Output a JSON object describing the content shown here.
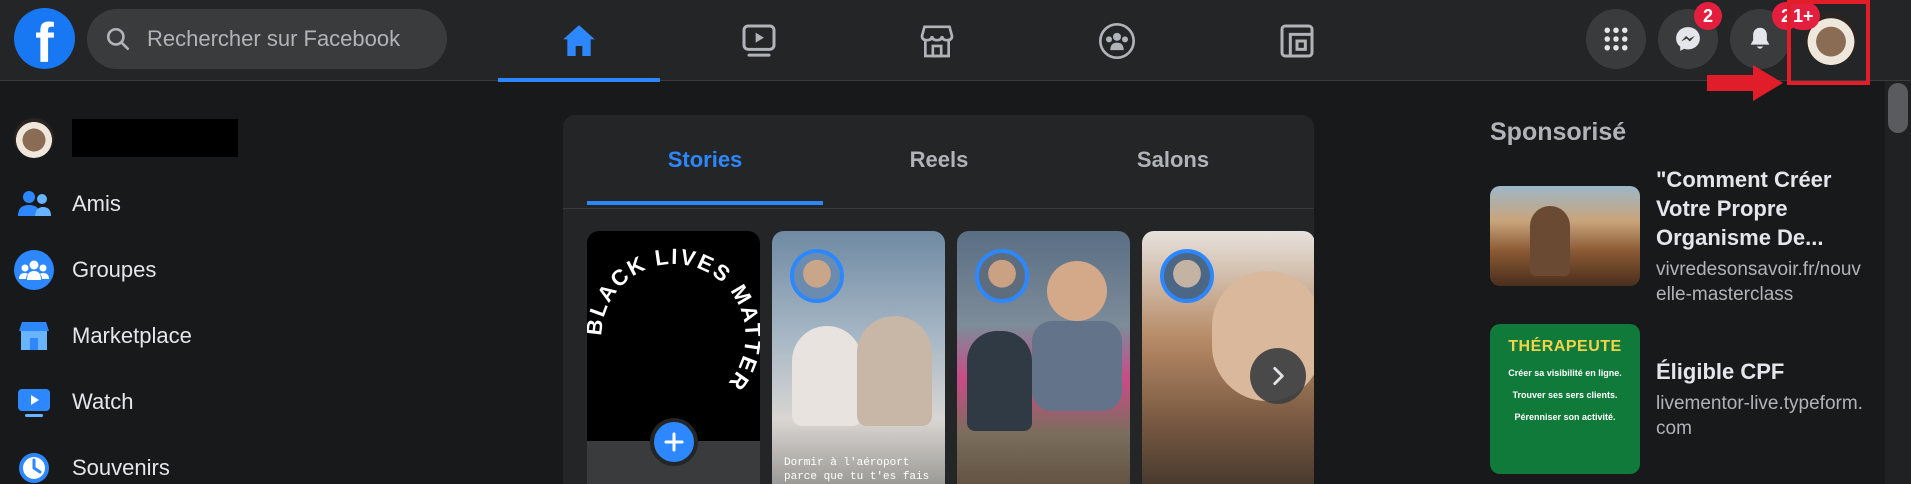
{
  "app": {
    "logo_letter": "f"
  },
  "search": {
    "placeholder": "Rechercher sur Facebook"
  },
  "nav": {
    "tabs": [
      {
        "id": "home",
        "icon": "home-icon",
        "active": true
      },
      {
        "id": "watch",
        "icon": "video-icon",
        "active": false
      },
      {
        "id": "marketplace",
        "icon": "store-icon",
        "active": false
      },
      {
        "id": "groups",
        "icon": "groups-icon",
        "active": false
      },
      {
        "id": "gaming",
        "icon": "gaming-icon",
        "active": false
      }
    ]
  },
  "header_actions": {
    "messenger_badge": "2",
    "notifications_badge": "2",
    "profile_badge": "1+"
  },
  "sidebar": {
    "items": [
      {
        "label": "Amis",
        "icon": "friends-icon"
      },
      {
        "label": "Groupes",
        "icon": "groups-icon"
      },
      {
        "label": "Marketplace",
        "icon": "marketplace-icon"
      },
      {
        "label": "Watch",
        "icon": "watch-icon"
      },
      {
        "label": "Souvenirs",
        "icon": "memories-icon"
      }
    ]
  },
  "stories": {
    "tabs": [
      "Stories",
      "Reels",
      "Salons"
    ],
    "active_tab": "Stories",
    "circle_text": "BLACK LIVES MATTER",
    "story_caption": "Dormir à l'aéroport parce que tu t'es fais virer du"
  },
  "sponsored": {
    "title": "Sponsorisé",
    "ads": [
      {
        "title": "\"Comment Créer Votre Propre Organisme De...",
        "url": "vivredesonsavoir.fr/nouvelle-masterclass"
      },
      {
        "title": "Éligible CPF",
        "url": "livementor-live.typeform.com",
        "image_heading": "THÉRAPEUTE",
        "image_lines": [
          "Créer sa visibilité en ligne.",
          "Trouver ses sers clients.",
          "Pérenniser son activité."
        ]
      }
    ]
  },
  "colors": {
    "accent": "#2d88ff",
    "badge": "#e41e3f",
    "highlight": "#e11d2a",
    "background": "#18191a",
    "surface": "#242526"
  }
}
